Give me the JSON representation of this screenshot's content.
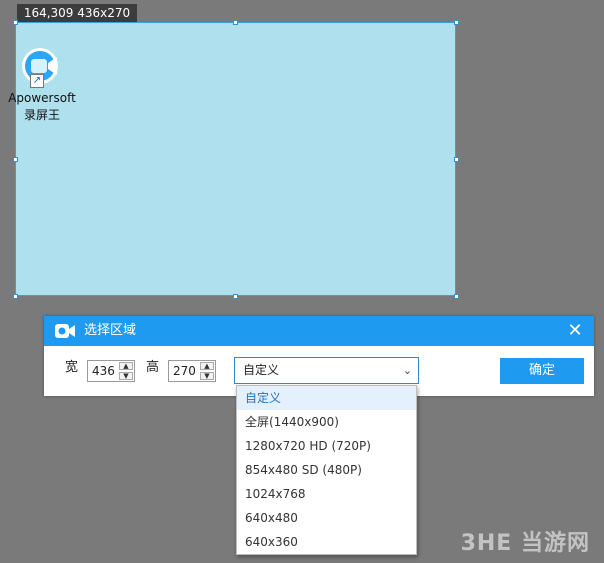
{
  "overlay": {
    "coords_label": "164,309 436x270"
  },
  "desktop_icon": {
    "label_line1": "Apowersoft",
    "label_line2": "录屏王",
    "icon": "video-camera-icon"
  },
  "dialog": {
    "title": "选择区域",
    "close_icon": "close-icon",
    "width_label": "宽",
    "width_value": "436",
    "height_label": "高",
    "height_value": "270",
    "preset_selected": "自定义",
    "confirm_label": "确定"
  },
  "dropdown": {
    "options": [
      "自定义",
      "全屏(1440x900)",
      "1280x720 HD (720P)",
      "854x480 SD (480P)",
      "1024x768",
      "640x480",
      "640x360"
    ]
  },
  "watermark": "3HE 当游网",
  "colors": {
    "accent": "#1e9bf0",
    "selection_fill": "#aee0ee",
    "desktop_bg": "#7a7a7a"
  }
}
